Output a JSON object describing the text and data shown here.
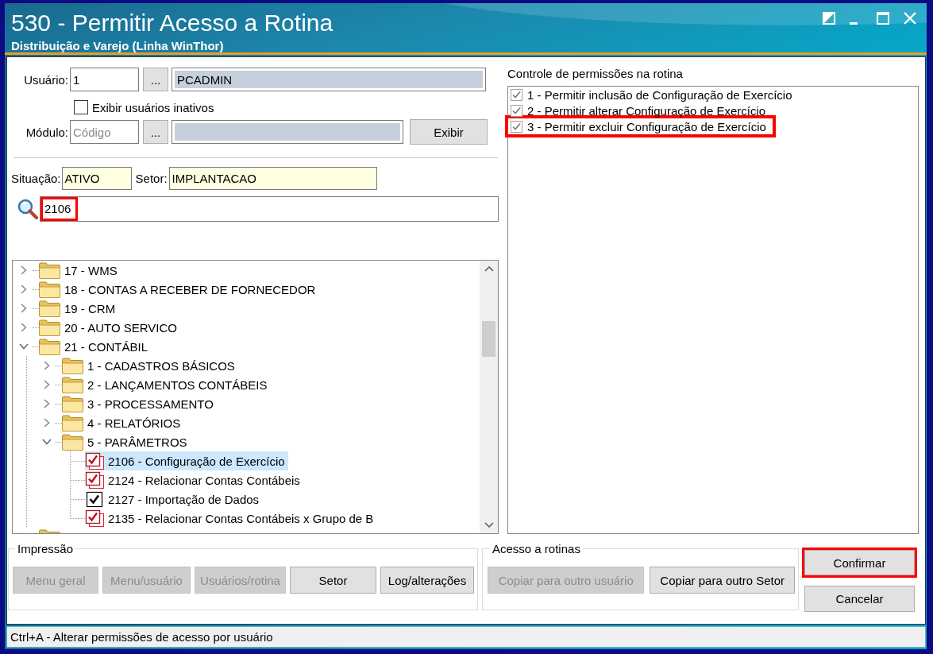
{
  "window": {
    "title": "530 - Permitir Acesso a Rotina",
    "subtitle": "Distribuição e Varejo (Linha WinThor)"
  },
  "user": {
    "label": "Usuário:",
    "code": "1",
    "lookup": "...",
    "name": "PCADMIN"
  },
  "inactive": {
    "label": "Exibir usuários inativos",
    "checked": false
  },
  "module": {
    "label": "Módulo:",
    "placeholder": "Código",
    "lookup": "...",
    "button": "Exibir"
  },
  "info": {
    "status_label": "Situação:",
    "status": "ATIVO",
    "sector_label": "Setor:",
    "sector": "IMPLANTACAO"
  },
  "search": {
    "value": "2106",
    "highlighted": true
  },
  "tree": {
    "items": [
      {
        "kind": "folder",
        "label": "17 - WMS",
        "expanded": false,
        "selected": false
      },
      {
        "kind": "folder",
        "label": "18 - CONTAS A RECEBER DE FORNECEDOR",
        "expanded": false,
        "selected": false
      },
      {
        "kind": "folder",
        "label": "19 - CRM",
        "expanded": false,
        "selected": false
      },
      {
        "kind": "folder",
        "label": "20 - AUTO SERVICO",
        "expanded": false,
        "selected": false
      },
      {
        "kind": "folder",
        "label": "21 - CONTÁBIL",
        "expanded": true,
        "selected": false,
        "children": [
          {
            "kind": "folder",
            "label": "1 - CADASTROS BÁSICOS",
            "expanded": false,
            "selected": false
          },
          {
            "kind": "folder",
            "label": "2 - LANÇAMENTOS CONTÁBEIS",
            "expanded": false,
            "selected": false
          },
          {
            "kind": "folder",
            "label": "3 - PROCESSAMENTO",
            "expanded": false,
            "selected": false
          },
          {
            "kind": "folder",
            "label": "4 - RELATÓRIOS",
            "expanded": false,
            "selected": false
          },
          {
            "kind": "folder",
            "label": "5 - PARÂMETROS",
            "expanded": true,
            "selected": false,
            "children": [
              {
                "kind": "routine",
                "label": "2106 - Configuração de Exercício",
                "checked": true,
                "flagged": true,
                "selected": true
              },
              {
                "kind": "routine",
                "label": "2124 - Relacionar Contas Contábeis",
                "checked": true,
                "flagged": true,
                "selected": false
              },
              {
                "kind": "routine",
                "label": "2127 - Importação de Dados",
                "checked": true,
                "flagged": false,
                "selected": false
              },
              {
                "kind": "routine",
                "label": "2135 - Relacionar Contas Contábeis x Grupo de B",
                "checked": true,
                "flagged": true,
                "selected": false
              }
            ]
          }
        ]
      },
      {
        "kind": "folder",
        "expanded": false,
        "selected": false
      }
    ]
  },
  "permissions": {
    "title": "Controle de permissões na rotina",
    "items": [
      {
        "label": "1 - Permitir inclusão de Configuração de Exercício",
        "checked": true,
        "highlighted": false
      },
      {
        "label": "2 - Permitir alterar Configuração de Exercício",
        "checked": true,
        "highlighted": false
      },
      {
        "label": "3 - Permitir excluir Configuração de Exercício",
        "checked": true,
        "highlighted": true
      }
    ]
  },
  "print_group": {
    "title": "Impressão",
    "buttons": [
      {
        "label": "Menu geral",
        "disabled": true
      },
      {
        "label": "Menu/usuário",
        "disabled": true
      },
      {
        "label": "Usuários/rotina",
        "disabled": true
      },
      {
        "label": "Setor",
        "disabled": false
      },
      {
        "label": "Log/alterações",
        "disabled": false
      }
    ]
  },
  "access_group": {
    "title": "Acesso a rotinas",
    "buttons": [
      {
        "label": "Copiar para outro usuário",
        "disabled": true
      },
      {
        "label": "Copiar para outro Setor",
        "disabled": false
      }
    ]
  },
  "actions": [
    {
      "label": "Confirmar",
      "highlighted": true
    },
    {
      "label": "Cancelar",
      "highlighted": false
    }
  ],
  "status_bar": {
    "text": "Ctrl+A - Alterar permissões de acesso por usuário"
  }
}
